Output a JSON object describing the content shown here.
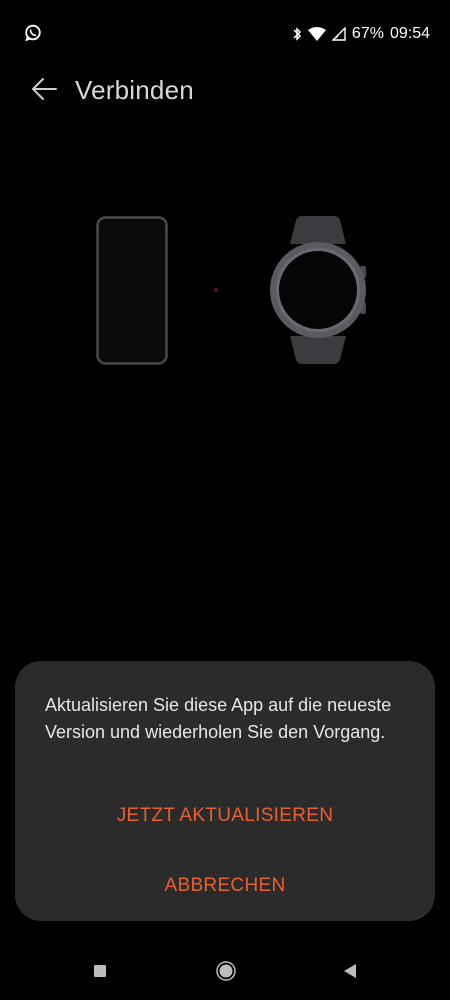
{
  "status_bar": {
    "notification_icon": "whatsapp-icon",
    "icons": [
      "bluetooth-icon",
      "wifi-icon",
      "signal-icon"
    ],
    "battery_percent": "67%",
    "time": "09:54"
  },
  "header": {
    "back_icon": "arrow-left-icon",
    "title": "Verbinden"
  },
  "illustration": {
    "left_device": "phone-icon",
    "right_device": "smartwatch-icon"
  },
  "dialog": {
    "message": "Aktualisieren Sie diese App auf die neueste Version und wiederholen Sie den Vorgang.",
    "primary_button": "JETZT AKTUALISIEREN",
    "secondary_button": "ABBRECHEN"
  },
  "nav_bar": {
    "icons": [
      "recent-apps-icon",
      "home-icon",
      "back-triangle-icon"
    ]
  },
  "colors": {
    "accent": "#e8602e",
    "background": "#000000",
    "dialog": "#2b2b2b"
  }
}
